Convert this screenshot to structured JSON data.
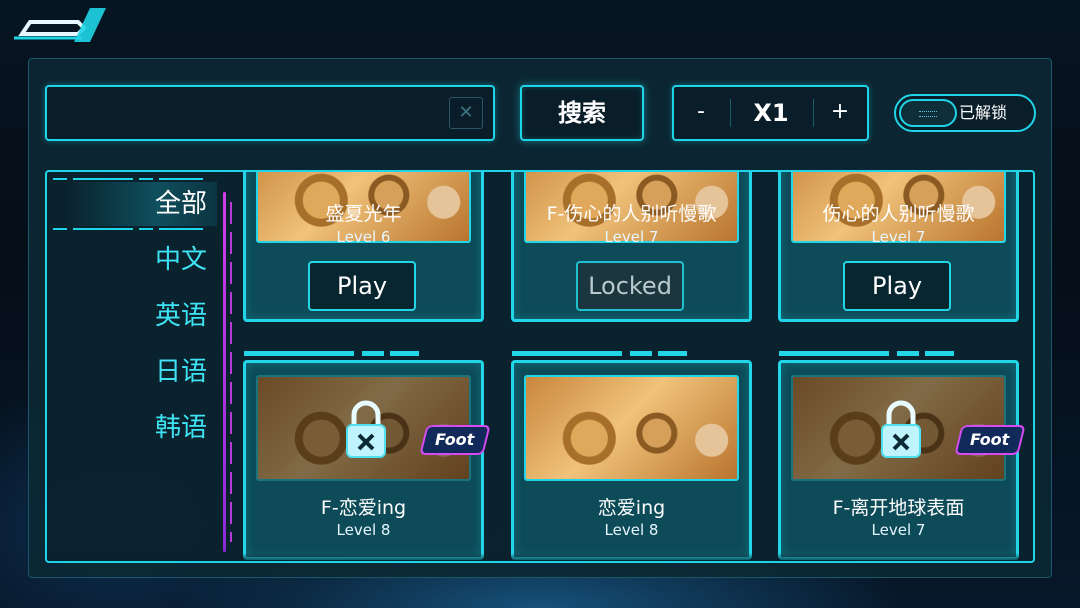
{
  "search": {
    "placeholder": "",
    "value": "",
    "button_label": "搜索",
    "clear_symbol": "✕"
  },
  "speed": {
    "minus_label": "-",
    "value": "X1",
    "plus_label": "+"
  },
  "unlock_toggle": {
    "label": "已解锁"
  },
  "sidebar": {
    "categories": [
      {
        "label": "全部",
        "active": true
      },
      {
        "label": "中文",
        "active": false
      },
      {
        "label": "英语",
        "active": false
      },
      {
        "label": "日语",
        "active": false
      },
      {
        "label": "韩语",
        "active": false
      }
    ]
  },
  "songs": [
    {
      "title": "盛夏光年",
      "level": "Level 6",
      "button": "Play",
      "locked": false,
      "badge": ""
    },
    {
      "title": "F-伤心的人别听慢歌",
      "level": "Level 7",
      "button": "Locked",
      "locked": true,
      "badge": ""
    },
    {
      "title": "伤心的人别听慢歌",
      "level": "Level 7",
      "button": "Play",
      "locked": false,
      "badge": ""
    },
    {
      "title": "F-恋爱ing",
      "level": "Level 8",
      "button": "",
      "locked": true,
      "badge": "Foot"
    },
    {
      "title": "恋爱ing",
      "level": "Level 8",
      "button": "",
      "locked": false,
      "badge": ""
    },
    {
      "title": "F-离开地球表面",
      "level": "Level 7",
      "button": "",
      "locked": true,
      "badge": "Foot"
    }
  ],
  "colors": {
    "accent": "#1fd4e6",
    "badge_border": "#d54bf0",
    "panel": "#0c2834"
  }
}
